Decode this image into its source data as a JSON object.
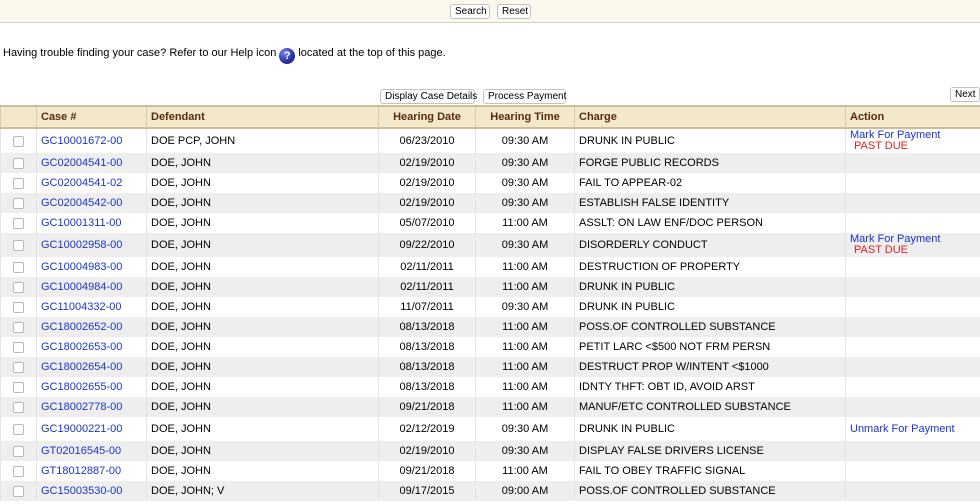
{
  "search_panel": {
    "search_label": "Search",
    "reset_label": "Reset"
  },
  "help": {
    "text_before": "Having trouble finding your case? Refer to our Help icon",
    "icon_glyph": "?",
    "text_after": "located at the top of this page."
  },
  "toolbar": {
    "display_details_label": "Display Case Details",
    "process_payment_label": "Process Payment",
    "next_label": "Next"
  },
  "table": {
    "headers": {
      "case": "Case #",
      "defendant": "Defendant",
      "hearing_date": "Hearing Date",
      "hearing_time": "Hearing Time",
      "charge": "Charge",
      "action": "Action"
    },
    "rows": [
      {
        "case": "GC10001672-00",
        "defendant": "DOE PCP, JOHN",
        "date": "06/23/2010",
        "time": "09:30 AM",
        "charge": "DRUNK IN PUBLIC",
        "action": "Mark For Payment",
        "status": "PAST DUE"
      },
      {
        "case": "GC02004541-00",
        "defendant": "DOE, JOHN",
        "date": "02/19/2010",
        "time": "09:30 AM",
        "charge": "FORGE PUBLIC RECORDS",
        "action": "",
        "status": ""
      },
      {
        "case": "GC02004541-02",
        "defendant": "DOE, JOHN",
        "date": "02/19/2010",
        "time": "09:30 AM",
        "charge": "FAIL TO APPEAR-02",
        "action": "",
        "status": ""
      },
      {
        "case": "GC02004542-00",
        "defendant": "DOE, JOHN",
        "date": "02/19/2010",
        "time": "09:30 AM",
        "charge": "ESTABLISH FALSE IDENTITY",
        "action": "",
        "status": ""
      },
      {
        "case": "GC10001311-00",
        "defendant": "DOE, JOHN",
        "date": "05/07/2010",
        "time": "11:00 AM",
        "charge": "ASSLT: ON LAW ENF/DOC PERSON",
        "action": "",
        "status": ""
      },
      {
        "case": "GC10002958-00",
        "defendant": "DOE, JOHN",
        "date": "09/22/2010",
        "time": "09:30 AM",
        "charge": "DISORDERLY CONDUCT",
        "action": "Mark For Payment",
        "status": "PAST DUE"
      },
      {
        "case": "GC10004983-00",
        "defendant": "DOE, JOHN",
        "date": "02/11/2011",
        "time": "11:00 AM",
        "charge": "DESTRUCTION OF PROPERTY",
        "action": "",
        "status": ""
      },
      {
        "case": "GC10004984-00",
        "defendant": "DOE, JOHN",
        "date": "02/11/2011",
        "time": "11:00 AM",
        "charge": "DRUNK IN PUBLIC",
        "action": "",
        "status": ""
      },
      {
        "case": "GC11004332-00",
        "defendant": "DOE, JOHN",
        "date": "11/07/2011",
        "time": "09:30 AM",
        "charge": "DRUNK IN PUBLIC",
        "action": "",
        "status": ""
      },
      {
        "case": "GC18002652-00",
        "defendant": "DOE, JOHN",
        "date": "08/13/2018",
        "time": "11:00 AM",
        "charge": "POSS.OF CONTROLLED SUBSTANCE",
        "action": "",
        "status": ""
      },
      {
        "case": "GC18002653-00",
        "defendant": "DOE, JOHN",
        "date": "08/13/2018",
        "time": "11:00 AM",
        "charge": "PETIT LARC <$500 NOT FRM PERSN",
        "action": "",
        "status": ""
      },
      {
        "case": "GC18002654-00",
        "defendant": "DOE, JOHN",
        "date": "08/13/2018",
        "time": "11:00 AM",
        "charge": "DESTRUCT PROP W/INTENT <$1000",
        "action": "",
        "status": ""
      },
      {
        "case": "GC18002655-00",
        "defendant": "DOE, JOHN",
        "date": "08/13/2018",
        "time": "11:00 AM",
        "charge": "IDNTY THFT: OBT ID, AVOID ARST",
        "action": "",
        "status": ""
      },
      {
        "case": "GC18002778-00",
        "defendant": "DOE, JOHN",
        "date": "09/21/2018",
        "time": "11:00 AM",
        "charge": "MANUF/ETC CONTROLLED SUBSTANCE",
        "action": "",
        "status": ""
      },
      {
        "case": "GC19000221-00",
        "defendant": "DOE, JOHN",
        "date": "02/12/2019",
        "time": "09:30 AM",
        "charge": "DRUNK IN PUBLIC",
        "action": "Unmark For Payment",
        "status": ""
      },
      {
        "case": "GT02016545-00",
        "defendant": "DOE, JOHN",
        "date": "02/19/2010",
        "time": "09:30 AM",
        "charge": "DISPLAY FALSE DRIVERS LICENSE",
        "action": "",
        "status": ""
      },
      {
        "case": "GT18012887-00",
        "defendant": "DOE, JOHN",
        "date": "09/21/2018",
        "time": "11:00 AM",
        "charge": "FAIL TO OBEY TRAFFIC SIGNAL",
        "action": "",
        "status": ""
      },
      {
        "case": "GC15003530-00",
        "defendant": "DOE, JOHN; V",
        "date": "09/17/2015",
        "time": "09:00 AM",
        "charge": "POSS.OF CONTROLLED SUBSTANCE",
        "action": "",
        "status": ""
      }
    ]
  },
  "colors": {
    "header_bg": "#f3e8c9",
    "header_text": "#5a2c0e",
    "link": "#1a35c8",
    "past_due": "#e02020",
    "stripe": "#eeeeee"
  }
}
